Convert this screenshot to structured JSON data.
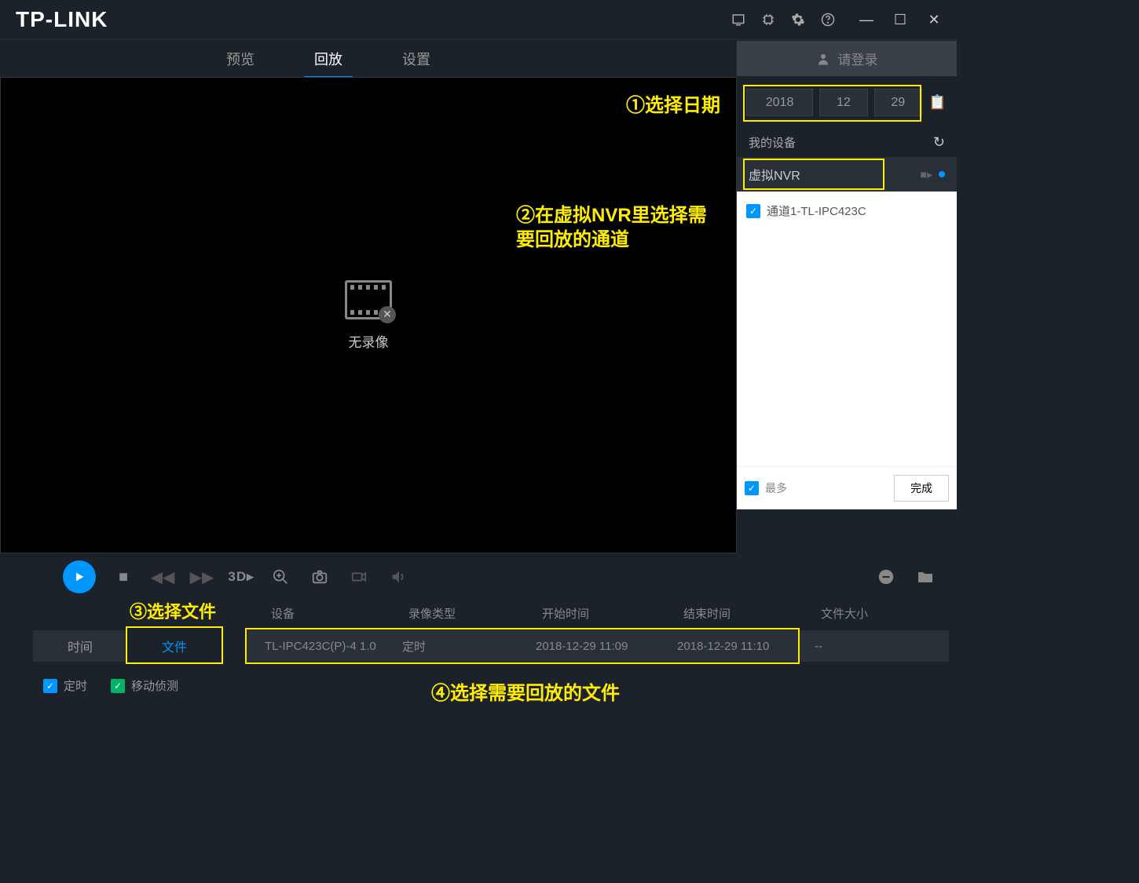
{
  "logo": "TP-LINK",
  "nav": {
    "tabs": [
      "预览",
      "回放",
      "设置"
    ],
    "active": 1,
    "login": "请登录"
  },
  "annotations": {
    "a1": "①选择日期",
    "a2": "②在虚拟NVR里选择需要回放的通道",
    "a3": "③选择文件",
    "a4": "④选择需要回放的文件"
  },
  "video": {
    "empty_text": "无录像"
  },
  "date": {
    "year": "2018",
    "month": "12",
    "day": "29"
  },
  "devices": {
    "header": "我的设备",
    "nvr": "虚拟NVR",
    "channels": [
      "通道1-TL-IPC423C"
    ],
    "more": "最多",
    "done": "完成"
  },
  "controls": {
    "threed": "3D▸"
  },
  "filelist": {
    "tabs": {
      "time": "时间",
      "file": "文件"
    },
    "headers": {
      "device": "设备",
      "type": "录像类型",
      "start": "开始时间",
      "end": "结束时间",
      "size": "文件大小"
    },
    "row": {
      "device": "TL-IPC423C(P)-4 1.0",
      "type": "定时",
      "start": "2018-12-29 11:09",
      "end": "2018-12-29 11:10",
      "size": "--"
    }
  },
  "filters": {
    "scheduled": "定时",
    "motion": "移动侦测"
  }
}
